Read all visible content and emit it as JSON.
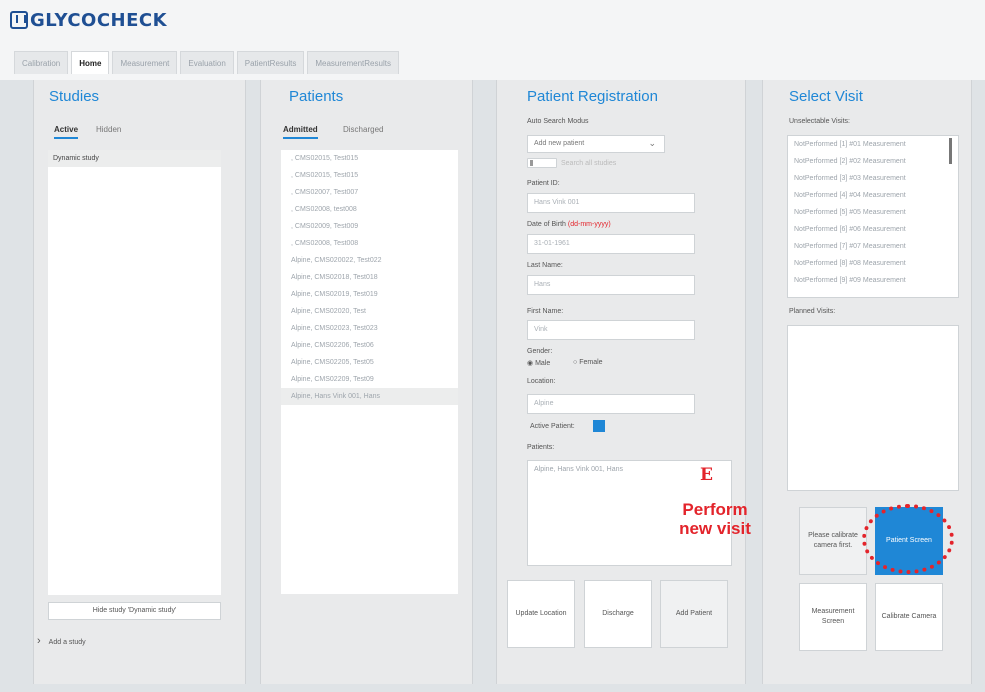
{
  "app": {
    "logo": "GLYCOCHECK"
  },
  "tabs": [
    "Calibration",
    "Home",
    "Measurement",
    "Evaluation",
    "PatientResults",
    "MeasurementResults"
  ],
  "studies": {
    "title": "Studies",
    "subtabs": [
      "Active",
      "Hidden"
    ],
    "items": [
      "Dynamic study"
    ],
    "hide_button": "Hide study 'Dynamic study'",
    "add_study": "Add a study"
  },
  "patients": {
    "title": "Patients",
    "subtabs": [
      "Admitted",
      "Discharged"
    ],
    "items": [
      ", CMS02015, Test015",
      ", CMS02015, Test015",
      ", CMS02007, Test007",
      ", CMS02008, test008",
      ", CMS02009, Test009",
      ", CMS02008, Test008",
      "Alpine, CMS020022, Test022",
      "Alpine, CMS02018, Test018",
      "Alpine, CMS02019, Test019",
      "Alpine, CMS02020, Test",
      "Alpine, CMS02023, Test023",
      "Alpine, CMS02206, Test06",
      "Alpine, CMS02205, Test05",
      "Alpine, CMS02209, Test09",
      "Alpine, Hans Vink 001, Hans"
    ]
  },
  "registration": {
    "title": "Patient Registration",
    "auto_search_label": "Auto Search Modus",
    "auto_search_value": "Add new patient",
    "search_all_label": "Search all studies",
    "patient_id_label": "Patient ID:",
    "patient_id_value": "Hans Vink 001",
    "dob_label": "Date of Birth",
    "dob_format": "(dd-mm-yyyy)",
    "dob_value": "31-01-1961",
    "last_name_label": "Last Name:",
    "last_name_value": "Hans",
    "first_name_label": "First Name:",
    "first_name_value": "Vink",
    "gender_label": "Gender:",
    "gender_male": "Male",
    "gender_female": "Female",
    "location_label": "Location:",
    "location_value": "Alpine",
    "active_patient_label": "Active Patient:",
    "patients_label": "Patients:",
    "patients_value": "Alpine, Hans Vink 001, Hans",
    "buttons": {
      "update_location": "Update Location",
      "discharge": "Discharge",
      "add_patient": "Add Patient"
    }
  },
  "visit": {
    "title": "Select Visit",
    "unselectable_label": "Unselectable Visits:",
    "unselectable_items": [
      "NotPerformed [1] #01 Measurement",
      "NotPerformed [2] #02 Measurement",
      "NotPerformed [3] #03 Measurement",
      "NotPerformed [4] #04 Measurement",
      "NotPerformed [5] #05 Measurement",
      "NotPerformed [6] #06 Measurement",
      "NotPerformed [7] #07 Measurement",
      "NotPerformed [8] #08 Measurement",
      "NotPerformed [9] #09 Measurement"
    ],
    "planned_label": "Planned Visits:",
    "buttons": {
      "calibrate_first": "Please calibrate camera first.",
      "patient_screen": "Patient Screen",
      "measurement_screen": "Measurement Screen",
      "calibrate_camera": "Calibrate Camera"
    }
  },
  "annotation": {
    "letter": "E",
    "text_line1": "Perform",
    "text_line2": "new visit"
  },
  "colors": {
    "accent": "#1f87d6",
    "annotation": "#e3242b"
  }
}
